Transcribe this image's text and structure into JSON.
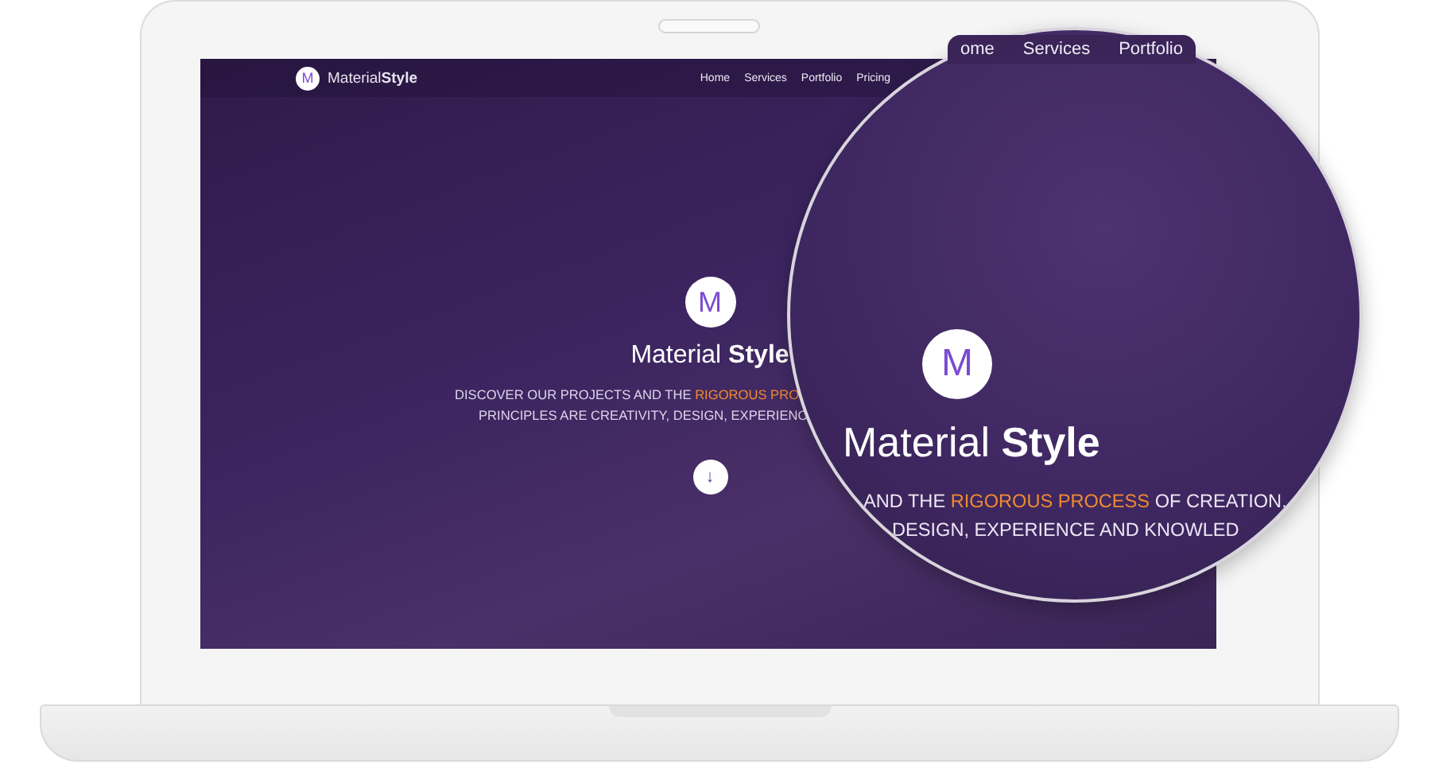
{
  "site": {
    "logo_letter": "M",
    "brand": "Material**Style**",
    "nav": [
      {
        "label": "Home"
      },
      {
        "label": "Services"
      },
      {
        "label": "Portfolio"
      },
      {
        "label": "Pricing"
      }
    ],
    "hero": {
      "logo_letter": "M",
      "title": "Material **Style**",
      "tagline": [
        [
          {
            "text": "DISCOVER OUR PROJECTS AND THE ",
            "highlight": false
          },
          {
            "text": "RIGOROUS PRO",
            "highlight": true
          }
        ],
        [
          {
            "text": "PRINCIPLES ARE CREATIVITY, DESIGN, EXPERIENC",
            "highlight": false
          }
        ]
      ],
      "scroll_button": "↓"
    }
  },
  "magnifier": {
    "nav": [
      {
        "label": "ome"
      },
      {
        "label": "Services"
      },
      {
        "label": "Portfolio"
      }
    ],
    "logo_letter": "M",
    "title": "Material **Style**",
    "tagline": [
      [
        {
          "text": "AND THE ",
          "highlight": false
        },
        {
          "text": "RIGOROUS PROCESS",
          "highlight": true
        },
        {
          "text": " OF CREATION.",
          "highlight": false
        }
      ],
      [
        {
          "text": "DESIGN, EXPERIENCE AND KNOWLED",
          "highlight": false
        }
      ]
    ]
  }
}
